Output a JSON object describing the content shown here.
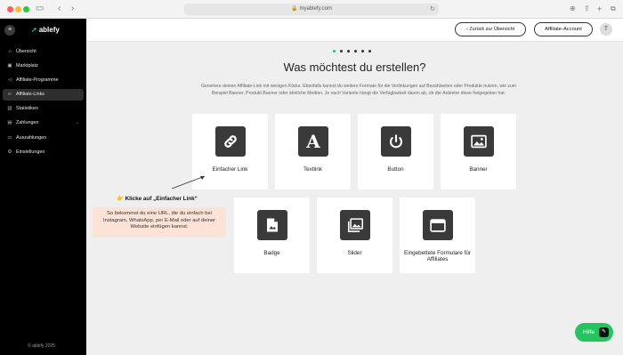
{
  "browser": {
    "url": "myablefy.com"
  },
  "sidebar": {
    "logo": "ablefy",
    "items": [
      {
        "label": "Übersicht",
        "icon": "home-icon"
      },
      {
        "label": "Marktplatz",
        "icon": "store-icon"
      },
      {
        "label": "Affiliate-Programme",
        "icon": "megaphone-icon"
      },
      {
        "label": "Affiliate-Links",
        "icon": "link-icon",
        "active": true
      },
      {
        "label": "Statistiken",
        "icon": "chart-icon"
      },
      {
        "label": "Zahlungen",
        "icon": "payments-icon",
        "expandable": true
      },
      {
        "label": "Auszahlungen",
        "icon": "payout-icon"
      },
      {
        "label": "Einstellungen",
        "icon": "settings-icon"
      }
    ],
    "footer": "© ablefy 2025"
  },
  "header": {
    "back_label": "Zurück zur Übersicht",
    "account_label": "Affiliate-Account",
    "avatar_initial": "T"
  },
  "wizard": {
    "step_total": 6,
    "step_active": 1,
    "title": "Was möchtest du erstellen?",
    "description": "Generiere deinen Affiliate-Link mit wenigen Klicks. Ebenfalls kannst du weitere Formate für die Verlinkungen auf Bezahlseiten oder Produkte nutzen, wie zum Beispiel Banner, Produkt-Banner oder ähnliche Medien. Je nach Variante hängt die Verfügbarkeit davon ab, ob der Anbieter diese freigegeben hat.",
    "options": [
      {
        "label": "Einfacher Link",
        "icon": "link-icon"
      },
      {
        "label": "Textlink",
        "icon": "text-a-icon"
      },
      {
        "label": "Button",
        "icon": "power-button-icon"
      },
      {
        "label": "Banner",
        "icon": "image-icon"
      },
      {
        "label": "Badge",
        "icon": "badge-file-icon"
      },
      {
        "label": "Slider",
        "icon": "gallery-icon"
      },
      {
        "label": "Eingebettete Formulare für Affiliates",
        "icon": "embed-window-icon"
      }
    ]
  },
  "annotation": {
    "title": "👉 Klicke auf „Einfacher Link“",
    "text": "So bekommst du eine URL, die du einfach bei Instagram, WhatsApp, per E-Mail oder auf deiner Website einfügen kannst."
  },
  "help": {
    "label": "Hilfe"
  },
  "colors": {
    "accent": "#22c55e",
    "sidebar_bg": "#000000",
    "annotation_bg": "#fde2d6",
    "icon_tile": "#3a3a3a"
  }
}
